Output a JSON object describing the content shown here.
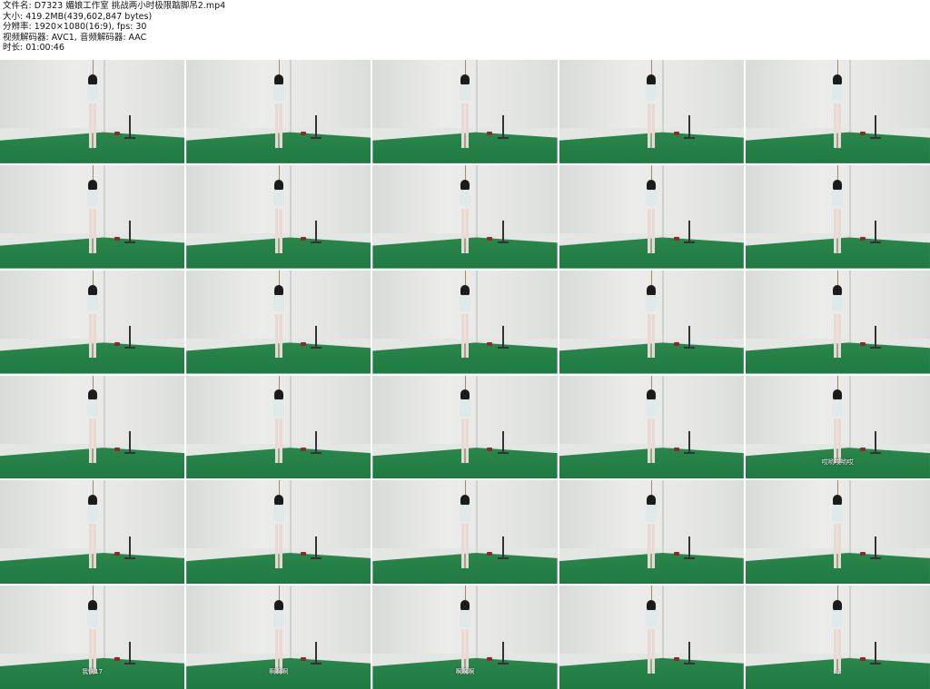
{
  "header": {
    "filename": "文件名: D7323 媚娘工作室 挑战两小时极限踮脚吊2.mp4",
    "size": "大小: 419.2MB(439,602,847 bytes)",
    "resolution": "分辨率: 1920×1080(16:9), fps: 30",
    "codec": "视频解码器: AVC1, 音频解码器: AAC",
    "duration": "时长: 01:00:46"
  },
  "thumbnails": [
    {
      "caption": ""
    },
    {
      "caption": ""
    },
    {
      "caption": ""
    },
    {
      "caption": ""
    },
    {
      "caption": ""
    },
    {
      "caption": ""
    },
    {
      "caption": ""
    },
    {
      "caption": ""
    },
    {
      "caption": ""
    },
    {
      "caption": ""
    },
    {
      "caption": ""
    },
    {
      "caption": ""
    },
    {
      "caption": ""
    },
    {
      "caption": ""
    },
    {
      "caption": ""
    },
    {
      "caption": ""
    },
    {
      "caption": ""
    },
    {
      "caption": ""
    },
    {
      "caption": ""
    },
    {
      "caption": "哎哟哎哟哎"
    },
    {
      "caption": ""
    },
    {
      "caption": ""
    },
    {
      "caption": ""
    },
    {
      "caption": ""
    },
    {
      "caption": ""
    },
    {
      "caption": "我快17"
    },
    {
      "caption": "啊啊啊"
    },
    {
      "caption": "啊啊啊"
    },
    {
      "caption": ""
    },
    {
      "caption": "4"
    }
  ]
}
